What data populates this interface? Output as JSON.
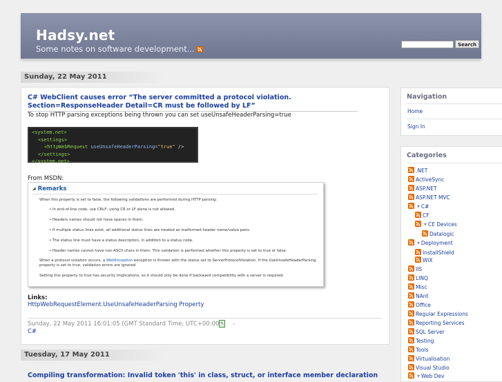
{
  "header": {
    "site_title": "Hadsy.net",
    "tagline": "Some notes on software development...",
    "search_placeholder": "",
    "search_button": "Search"
  },
  "posts": [
    {
      "date": "Sunday, 22 May 2011",
      "title": "C# WebClient causes error “The server committed a protocol violation. Section=ResponseHeader Detail=CR must be followed by LF”",
      "intro": "To stop HTTP parsing exceptions being thrown you can set useUnsafeHeaderParsing=true",
      "code": {
        "line1": "<system.net>",
        "line2": "<settings>",
        "line3_tag": "<httpWebRequest",
        "line3_attr": "useUnsafeHeaderParsing=",
        "line3_val": "\"true\"",
        "line3_end": "/>",
        "line4": "</settings>",
        "line5": "</system.net>"
      },
      "from_label": "From MSDN:",
      "remarks": {
        "title": "Remarks",
        "intro": "When this property is set to false, the following validations are performed during HTTP parsing:",
        "bullets": [
          "In end-of-line code, use CRLF; using CR or LF alone is not allowed.",
          "Headers names should not have spaces in them.",
          "If multiple status lines exist, all additional status lines are treated as malformed header name/value pairs.",
          "The status line must have a status description, in addition to a status code.",
          "Header names cannot have non-ASCII chars in them. This validation is performed whether this property is set to true or false."
        ],
        "para1_a": "When a protocol violation occurs, a ",
        "para1_link": "WebException",
        "para1_b": " exception is thrown with the status set to ServerProtocolViolation. If the UseUnsafeHeaderParsing",
        "para1_c": "property is set to true, validation errors are ignored.",
        "para2": "Setting this property to true has security implications, so it should only be done if backward compatibility with a server is required."
      },
      "links_label": "Links:",
      "link_1": "HttpWebRequestElement.UseUnsafeHeaderParsing Property",
      "footer_date": "Sunday, 22 May 2011 16:01:05 (GMT Standard Time, UTC+00:00)",
      "footer_dash": "-",
      "category": "C#"
    },
    {
      "date": "Tuesday, 17 May 2011",
      "title": "Compiling transformation: Invalid token 'this' in class, struct, or interface member declaration"
    }
  ],
  "sidebar": {
    "navigation": {
      "title": "Navigation",
      "items": [
        "Home",
        "Sign In"
      ]
    },
    "categories": {
      "title": "Categories",
      "items": [
        ".NET",
        "ActiveSync",
        "ASP.NET",
        "ASP.NET MVC",
        "C#",
        "CF",
        "CE Devices",
        "Datalogic",
        "Deployment",
        "InstallShield",
        "WiX",
        "IIS",
        "LINQ",
        "Misc",
        "NAnt",
        "Office",
        "Regular Expressions",
        "Reporting Services",
        "SQL Server",
        "Testing",
        "Tools",
        "Virtualisation",
        "Visual Studio",
        "Web Dev"
      ]
    }
  },
  "colors": {
    "header_bg": "#7b8299",
    "link": "#1a3e9e",
    "page_bg": "#efefef"
  }
}
